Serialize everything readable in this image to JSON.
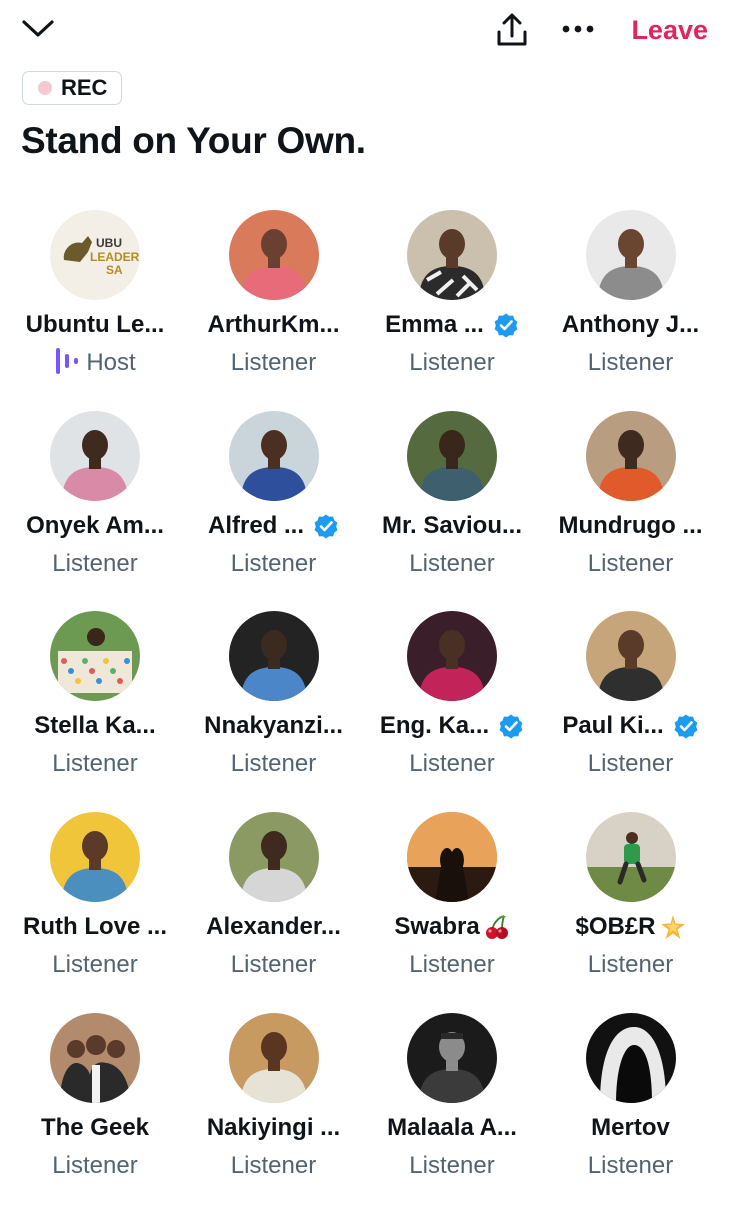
{
  "header": {
    "collapse_icon": "chevron-down-icon",
    "share_icon": "share-upload-icon",
    "more_icon": "more-dots-icon",
    "leave_label": "Leave",
    "leave_color": "#e0245e"
  },
  "recording": {
    "label": "REC"
  },
  "space": {
    "title": "Stand on Your Own."
  },
  "colors": {
    "verified": "#1d9bf0",
    "host": "#7856ff",
    "secondary_text": "#536471"
  },
  "participants": [
    {
      "name": "Ubuntu Le...",
      "role": "Host",
      "verified": false
    },
    {
      "name": "ArthurKm...",
      "role": "Listener",
      "verified": false
    },
    {
      "name": "Emma ...",
      "role": "Listener",
      "verified": true
    },
    {
      "name": "Anthony J...",
      "role": "Listener",
      "verified": false
    },
    {
      "name": "Onyek Am...",
      "role": "Listener",
      "verified": false
    },
    {
      "name": "Alfred ...",
      "role": "Listener",
      "verified": true
    },
    {
      "name": "Mr. Saviou...",
      "role": "Listener",
      "verified": false
    },
    {
      "name": "Mundrugo ...",
      "role": "Listener",
      "verified": false
    },
    {
      "name": "Stella Ka...",
      "role": "Listener",
      "verified": false
    },
    {
      "name": "Nnakyanzi...",
      "role": "Listener",
      "verified": false
    },
    {
      "name": "Eng. Ka...",
      "role": "Listener",
      "verified": true
    },
    {
      "name": "Paul Ki...",
      "role": "Listener",
      "verified": true
    },
    {
      "name": "Ruth Love ...",
      "role": "Listener",
      "verified": false
    },
    {
      "name": "Alexander...",
      "role": "Listener",
      "verified": false
    },
    {
      "name": "Swabra",
      "role": "Listener",
      "verified": false,
      "emoji": "cherries-emoji"
    },
    {
      "name": "$OB£R",
      "role": "Listener",
      "verified": false,
      "emoji": "sparkle-star-emoji"
    },
    {
      "name": "The Geek",
      "role": "Listener",
      "verified": false
    },
    {
      "name": "Nakiyingi ...",
      "role": "Listener",
      "verified": false
    },
    {
      "name": "Malaala A...",
      "role": "Listener",
      "verified": false
    },
    {
      "name": "Mertov",
      "role": "Listener",
      "verified": false
    }
  ]
}
